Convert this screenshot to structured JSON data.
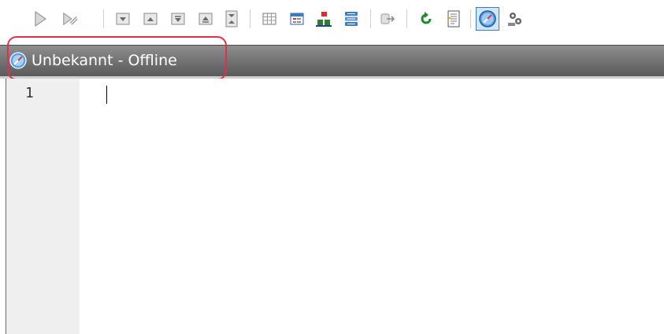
{
  "toolbar": {
    "buttons": [
      {
        "icon": "execute-icon"
      },
      {
        "icon": "execute-step-icon"
      },
      {
        "icon": "result-first-icon"
      },
      {
        "icon": "result-prev-icon"
      },
      {
        "icon": "result-next-icon"
      },
      {
        "icon": "result-last-icon"
      },
      {
        "icon": "result-all-icon"
      },
      {
        "icon": "grid-view-icon"
      },
      {
        "icon": "form-view-icon"
      },
      {
        "icon": "object-tree-icon"
      },
      {
        "icon": "database-list-icon"
      },
      {
        "icon": "export-icon"
      },
      {
        "icon": "refresh-icon"
      },
      {
        "icon": "script-icon"
      },
      {
        "icon": "connection-icon",
        "active": true
      },
      {
        "icon": "settings-icon"
      }
    ]
  },
  "connection": {
    "label": "Unbekannt - Offline",
    "icon": "compass-icon"
  },
  "editor": {
    "line_numbers": [
      "1"
    ]
  },
  "colors": {
    "highlight": "#e0304a",
    "bar": "#6f6f6f",
    "gutter": "#efefef"
  }
}
